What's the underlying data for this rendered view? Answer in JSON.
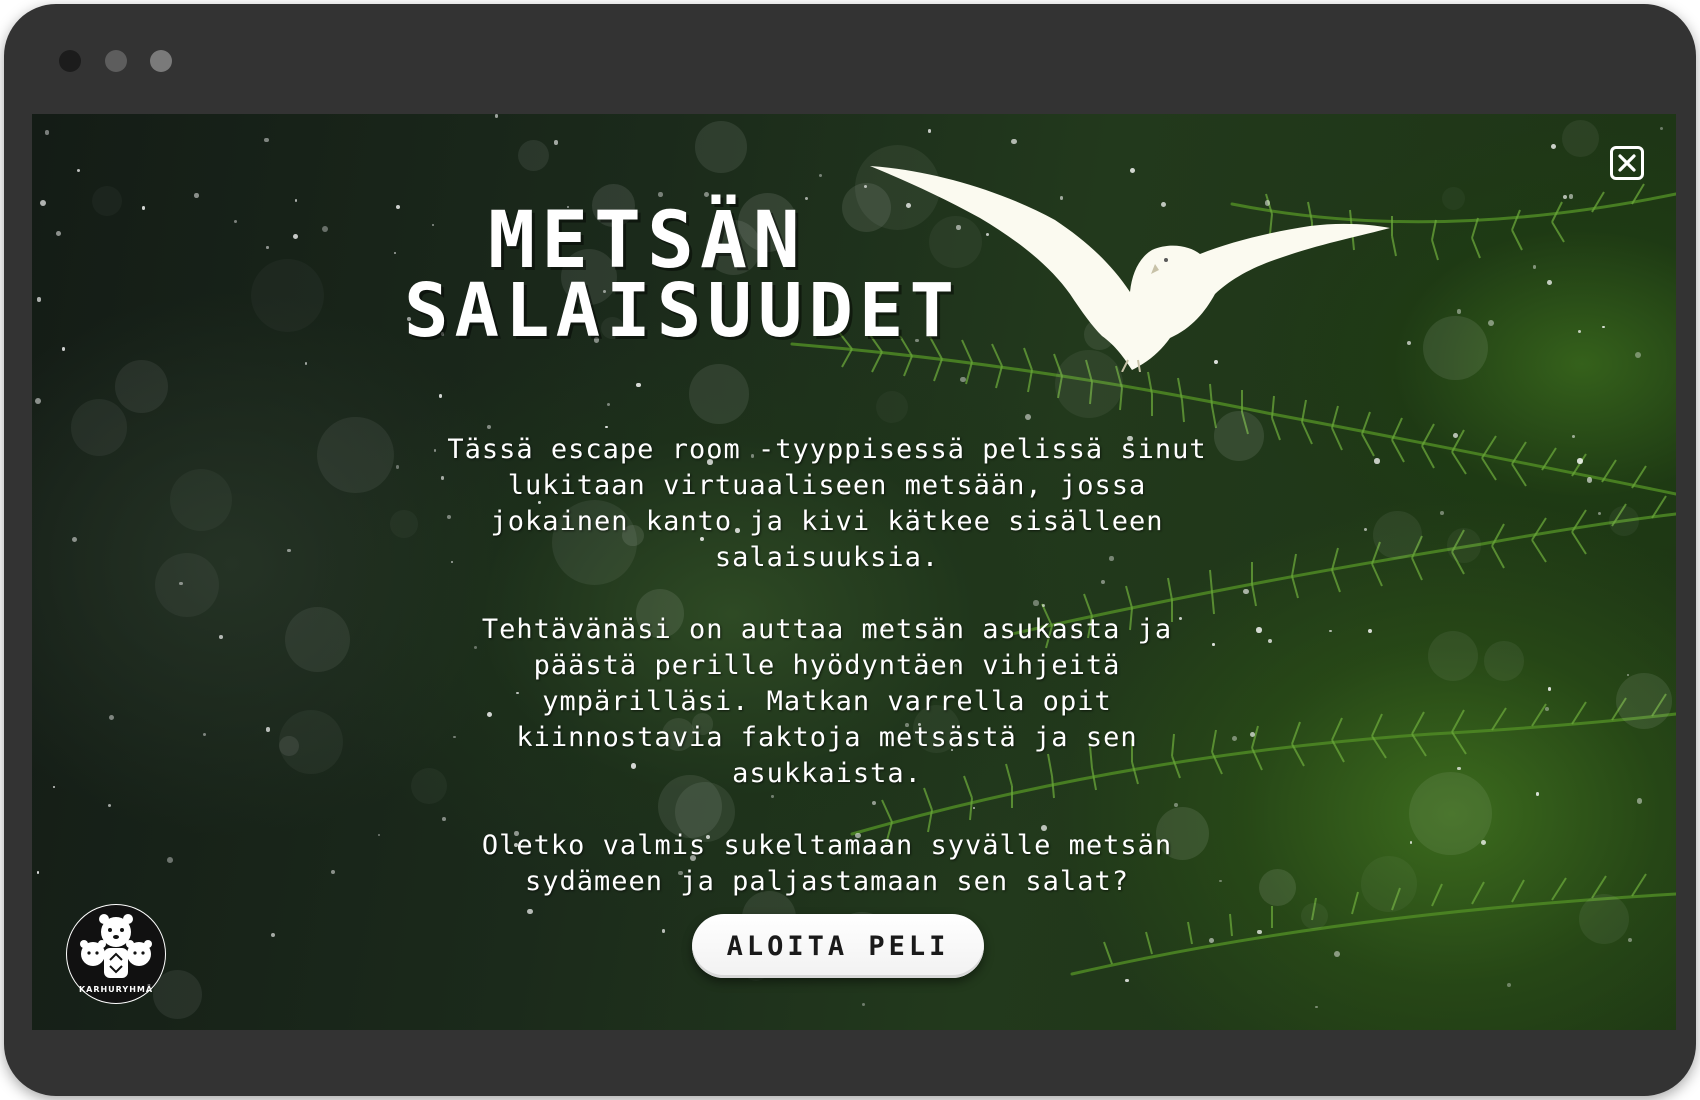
{
  "game": {
    "title_line_1": "METSÄN",
    "title_line_2": "SALAISUUDET",
    "paragraphs": [
      "Tässä escape room -tyyppisessä pelissä sinut lukitaan virtuaaliseen metsään, jossa jokainen kanto ja kivi kätkee sisälleen salaisuuksia.",
      "Tehtävänäsi on auttaa metsän asukasta ja päästä perille hyödyntäen vihjeitä ympärilläsi. Matkan varrella opit kiinnostavia faktoja metsästä ja sen asukkaista.",
      "Oletko valmis sukeltamaan syvälle metsän sydämeen ja paljastamaan sen salat?"
    ],
    "start_label": "ALOITA PELI",
    "logo_text": "KARHURYHMÄ"
  },
  "icons": {
    "close": "close-icon",
    "bird": "seagull-icon",
    "logo": "bear-family-logo-icon"
  },
  "colors": {
    "frame": "#333333",
    "bird": "#fbfaf0",
    "text": "#ffffff",
    "button": "#ffffff"
  }
}
